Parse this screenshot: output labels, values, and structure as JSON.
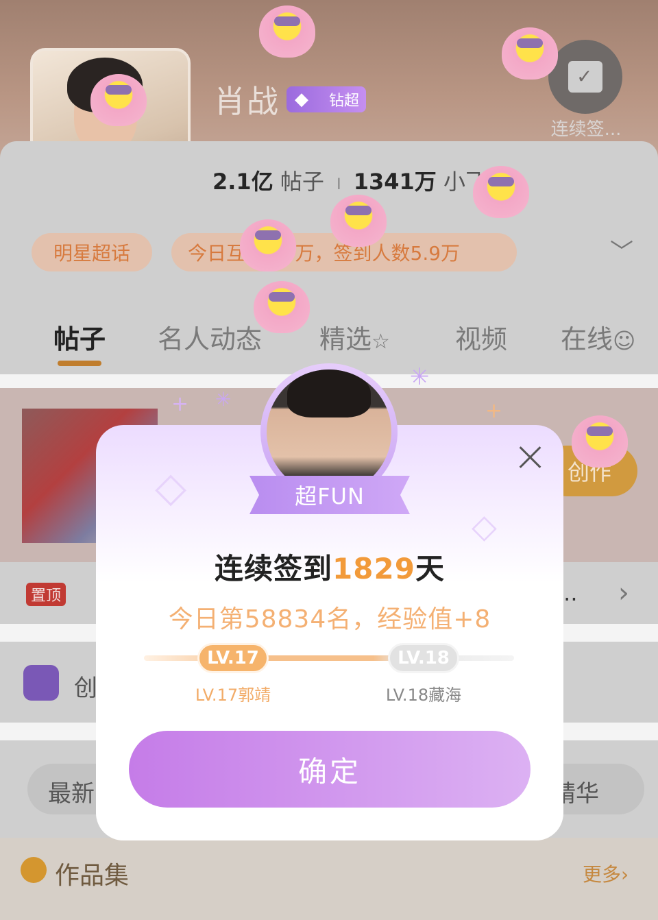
{
  "topic": {
    "name": "肖战",
    "badge_label": "钻超",
    "checkin_label": "连续签...",
    "stats": {
      "posts_value": "2.1亿",
      "posts_label": "帖子",
      "sep": "I",
      "fans_value": "1341万",
      "fans_label": "小飞"
    },
    "chip_category": "明星超话",
    "chip_stats": "今日互动9.8万，签到人数5.9万"
  },
  "tabs": [
    "帖子",
    "名人动态",
    "精选",
    "视频",
    "在线"
  ],
  "feed": {
    "create_label": "创作",
    "pinned_tag": "置顶",
    "pinned_text": "...",
    "row2_text": "创",
    "filter_left": "最新",
    "filter_right": "精华",
    "works_title": "作品集",
    "works_more": "更多"
  },
  "modal": {
    "ribbon_label": "超FUN",
    "headline_prefix": "连续签到",
    "headline_days": "1829",
    "headline_suffix": "天",
    "subline": "今日第58834名，经验值+8",
    "level_current": "LV.17",
    "level_current_name": "LV.17郭靖",
    "level_next": "LV.18",
    "level_next_name": "LV.18藏海",
    "confirm_label": "确定"
  },
  "colors": {
    "accent_orange": "#f29a3a",
    "accent_purple": "#c57ce8",
    "pin_red": "#c13a33"
  },
  "icons": [
    "diamond-badge-icon",
    "calendar-check-icon",
    "chevron-down-icon",
    "close-icon",
    "chevron-right-icon",
    "medal-icon",
    "edit-icon"
  ]
}
